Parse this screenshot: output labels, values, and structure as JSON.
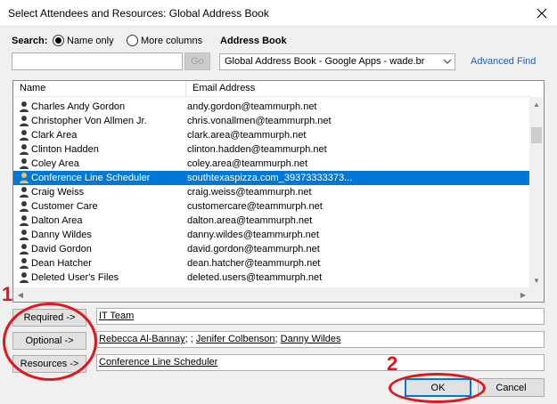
{
  "window": {
    "title": "Select Attendees and Resources: Global Address Book"
  },
  "search": {
    "label": "Search:",
    "option_name_only": "Name only",
    "option_more_columns": "More columns",
    "selected": "Name only",
    "query": "",
    "go_label": "Go"
  },
  "address_book": {
    "label": "Address Book",
    "selected": "Global Address Book - Google Apps - wade.br",
    "advanced_find": "Advanced Find"
  },
  "list": {
    "columns": [
      "Name",
      "Email Address"
    ],
    "rows": [
      {
        "name": "Charles Andy Gordon",
        "email": "andy.gordon@teammurph.net"
      },
      {
        "name": "Christopher Von Allmen Jr.",
        "email": "chris.vonallmen@teammurph.net"
      },
      {
        "name": "Clark Area",
        "email": "clark.area@teammurph.net"
      },
      {
        "name": "Clinton Hadden",
        "email": "clinton.hadden@teammurph.net"
      },
      {
        "name": "Coley Area",
        "email": "coley.area@teammurph.net"
      },
      {
        "name": "Conference Line Scheduler",
        "email": "southtexaspizza.com_39373333373...",
        "selected": true
      },
      {
        "name": "Craig Weiss",
        "email": "craig.weiss@teammurph.net"
      },
      {
        "name": "Customer Care",
        "email": "customercare@teammurph.net"
      },
      {
        "name": "Dalton Area",
        "email": "dalton.area@teammurph.net"
      },
      {
        "name": "Danny Wildes",
        "email": "danny.wildes@teammurph.net"
      },
      {
        "name": "David Gordon",
        "email": "david.gordon@teammurph.net"
      },
      {
        "name": "Dean Hatcher",
        "email": "dean.hatcher@teammurph.net"
      },
      {
        "name": "Deleted User's Files",
        "email": "deleted.users@teammurph.net"
      }
    ]
  },
  "recipients": {
    "required_label": "Required ->",
    "required_value": "IT Team",
    "optional_label": "Optional ->",
    "optional_values": [
      "Rebecca Al-Bannay",
      "Jenifer Colbenson",
      "Danny Wildes"
    ],
    "optional_sep": ";",
    "resources_label": "Resources ->",
    "resources_value": "Conference Line Scheduler"
  },
  "footer": {
    "ok_label": "OK",
    "cancel_label": "Cancel"
  },
  "annotations": {
    "one": "1",
    "two": "2",
    "color": "#e0161b"
  }
}
